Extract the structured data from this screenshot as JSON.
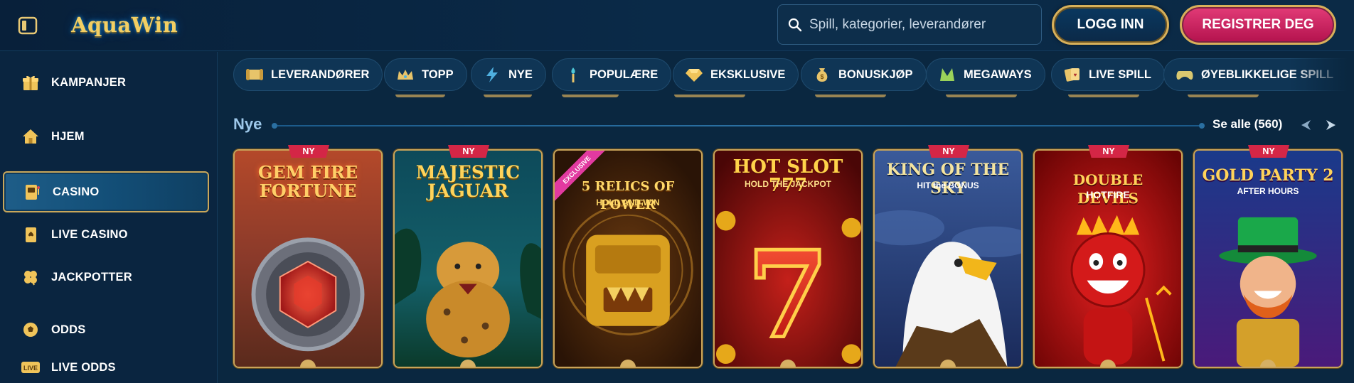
{
  "header": {
    "logo_text": "AquaWin",
    "search_placeholder": "Spill, kategorier, leverandører",
    "login_label": "LOGG INN",
    "register_label": "REGISTRER DEG"
  },
  "sidebar": {
    "items": [
      {
        "label": "KAMPANJER",
        "icon": "gift-icon",
        "active": false
      },
      {
        "label": "HJEM",
        "icon": "home-icon",
        "active": false
      },
      {
        "label": "CASINO",
        "icon": "slot-machine-icon",
        "active": true
      },
      {
        "label": "LIVE CASINO",
        "icon": "playing-card-icon",
        "active": false
      },
      {
        "label": "JACKPOTTER",
        "icon": "clover-icon",
        "active": false
      },
      {
        "label": "ODDS",
        "icon": "soccer-ball-icon",
        "active": false
      },
      {
        "label": "LIVE ODDS",
        "icon": "live-badge-icon",
        "active": false
      },
      {
        "live_badge": "LIVE"
      }
    ]
  },
  "categories": [
    {
      "label": "LEVERANDØRER",
      "icon": "scroll-icon"
    },
    {
      "label": "TOPP",
      "icon": "crown-icon"
    },
    {
      "label": "NYE",
      "icon": "lightning-icon"
    },
    {
      "label": "POPULÆRE",
      "icon": "torch-icon"
    },
    {
      "label": "EKSKLUSIVE",
      "icon": "diamond-icon"
    },
    {
      "label": "BONUSKJØP",
      "icon": "money-bag-icon"
    },
    {
      "label": "MEGAWAYS",
      "icon": "megaways-icon"
    },
    {
      "label": "LIVE SPILL",
      "icon": "cards-icon"
    },
    {
      "label": "ØYEBLIKKELIGE SPILL",
      "icon": "gamepad-icon"
    }
  ],
  "section": {
    "title": "Nye",
    "see_all": "Se alle (560)"
  },
  "games": [
    {
      "title": "GEM FIRE FORTUNE",
      "subtitle": "",
      "badge": "NY",
      "ribbon": ""
    },
    {
      "title": "MAJESTIC JAGUAR",
      "subtitle": "",
      "badge": "NY",
      "ribbon": ""
    },
    {
      "title": "5 RELICS OF POWER",
      "subtitle": "HOLD AND WIN",
      "badge": "",
      "ribbon": "EXCLUSIVE"
    },
    {
      "title": "HOT SLOT 777",
      "subtitle": "HOLD THE JACKPOT",
      "badge": "",
      "ribbon": ""
    },
    {
      "title": "KING OF THE SKY",
      "subtitle": "HIT the BONUS",
      "badge": "NY",
      "ribbon": ""
    },
    {
      "title": "DOUBLE DEVILS",
      "subtitle": "HOTFIRE",
      "badge": "NY",
      "ribbon": ""
    },
    {
      "title": "GOLD PARTY 2",
      "subtitle": "AFTER HOURS",
      "badge": "NY",
      "ribbon": ""
    }
  ],
  "colors": {
    "background": "#0a2740",
    "gold": "#c9a45a",
    "register": "#d42a66",
    "badge": "#d42646",
    "section_title": "#9ec8ea"
  }
}
